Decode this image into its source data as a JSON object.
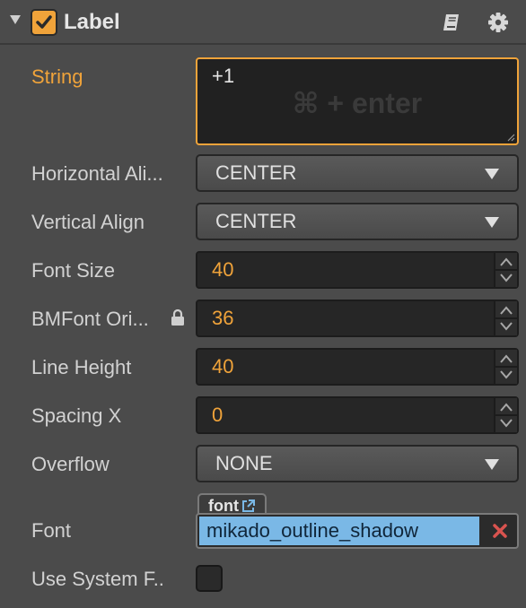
{
  "header": {
    "title": "Label",
    "enabled": true,
    "icons": [
      "triangle-down-icon",
      "checkmark-icon",
      "help-book-icon",
      "gear-icon"
    ]
  },
  "properties": {
    "string": {
      "label": "String",
      "value": "+1",
      "hint": "⌘ + enter"
    },
    "horizontal_align": {
      "label": "Horizontal Ali...",
      "value": "CENTER"
    },
    "vertical_align": {
      "label": "Vertical Align",
      "value": "CENTER"
    },
    "font_size": {
      "label": "Font Size",
      "value": "40"
    },
    "bmfont_original_size": {
      "label": "BMFont Ori...",
      "value": "36"
    },
    "line_height": {
      "label": "Line Height",
      "value": "40"
    },
    "spacing_x": {
      "label": "Spacing X",
      "value": "0"
    },
    "overflow": {
      "label": "Overflow",
      "value": "NONE"
    },
    "font": {
      "label": "Font",
      "tag": "font",
      "value": "mikado_outline_shadow"
    },
    "use_system_font": {
      "label": "Use System F..",
      "checked": false
    }
  },
  "colors": {
    "accent": "#f0a33a",
    "panel_bg": "#4b4b4b",
    "asset_highlight": "#7ab8e6",
    "clear_red": "#d9534f"
  }
}
